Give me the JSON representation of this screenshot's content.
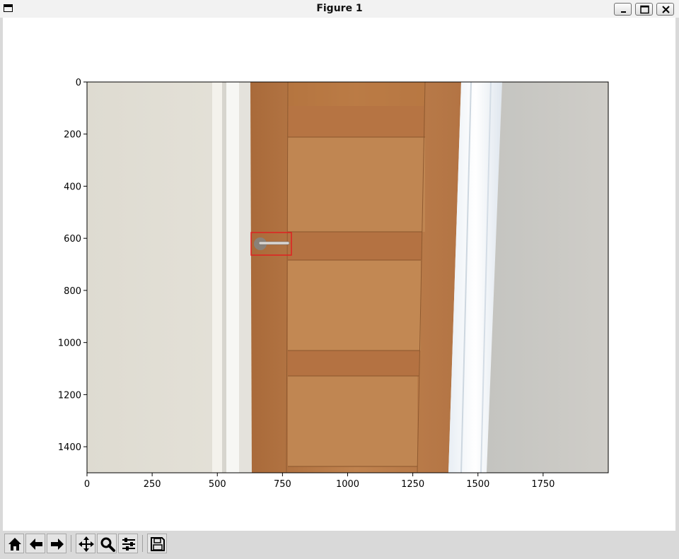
{
  "window": {
    "title": "Figure 1",
    "controls": [
      "minimize",
      "maximize",
      "close"
    ]
  },
  "figure": {
    "image_description_icon": "photo-of-wooden-door",
    "x_ticks": [
      "0",
      "250",
      "500",
      "750",
      "1000",
      "1250",
      "1500",
      "1750"
    ],
    "y_ticks": [
      "0",
      "200",
      "400",
      "600",
      "800",
      "1000",
      "1200",
      "1400"
    ],
    "x_range": [
      0,
      2000
    ],
    "y_range": [
      0,
      1500
    ],
    "annotation_box": {
      "x0": 630,
      "y0": 578,
      "x1": 785,
      "y1": 665,
      "color": "#e02020",
      "label": "door handle"
    },
    "colors": {
      "wall_left": "#e8e4da",
      "door_wood": "#b97a45",
      "door_frame": "#f3f5f7",
      "wall_right": "#c9c8c3"
    }
  },
  "toolbar": {
    "buttons": [
      "home",
      "back",
      "forward",
      "pan",
      "zoom",
      "configure-subplots",
      "save"
    ]
  }
}
